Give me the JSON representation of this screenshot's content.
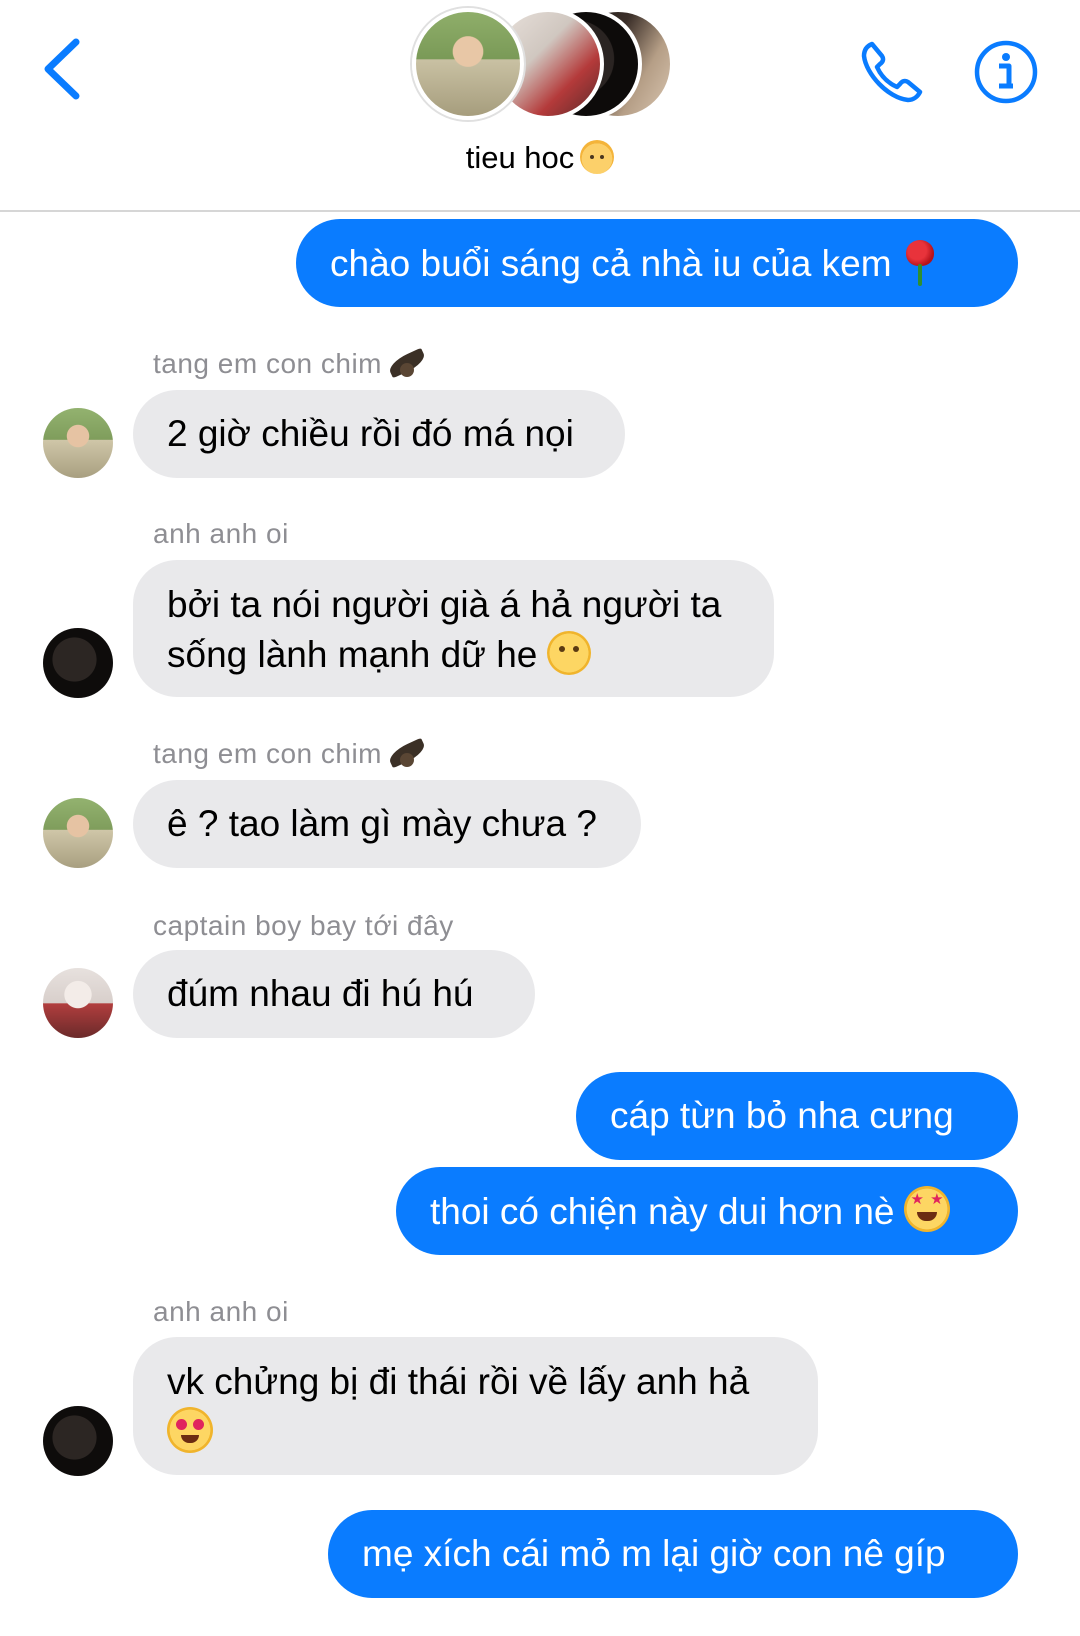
{
  "header": {
    "title": "tieu hoc",
    "title_emoji": "baby-emoji",
    "back_icon": "chevron-left-icon",
    "call_icon": "phone-icon",
    "info_icon": "info-icon",
    "accent_color": "#0a7cff"
  },
  "messages": [
    {
      "direction": "out",
      "text": "chào buổi sáng cả nhà iu của kem",
      "emoji": "rose-emoji"
    },
    {
      "direction": "in",
      "sender": "tang em con chim",
      "sender_emoji": "bird-emoji",
      "text": "2 giờ chiều rồi đó má nọi"
    },
    {
      "direction": "in",
      "sender": "anh anh oi",
      "text_line1": "bởi ta nói người già á hả người ta",
      "text_line2": "sống lành mạnh dữ he",
      "emoji": "face-with-hand-over-mouth-emoji"
    },
    {
      "direction": "in",
      "sender": "tang em con chim",
      "sender_emoji": "bird-emoji",
      "text": "ê ? tao làm gì mày chưa ?"
    },
    {
      "direction": "in",
      "sender": "captain boy bay tới đây",
      "text": "đúm nhau đi hú hú"
    },
    {
      "direction": "out",
      "text": "cáp từn bỏ nha cưng"
    },
    {
      "direction": "out",
      "text": "thoi có chiện này dui hơn nè",
      "emoji": "star-struck-emoji"
    },
    {
      "direction": "in",
      "sender": "anh anh oi",
      "text": "vk chửng bị đi thái rồi về lấy anh hả",
      "emoji": "heart-eyes-emoji"
    },
    {
      "direction": "out",
      "text": "mẹ xích cái mỏ m lại giờ con nê gíp"
    }
  ],
  "colors": {
    "outgoing_bubble": "#0a7cff",
    "incoming_bubble": "#e9e9eb",
    "sender_name": "#8e8e93"
  }
}
